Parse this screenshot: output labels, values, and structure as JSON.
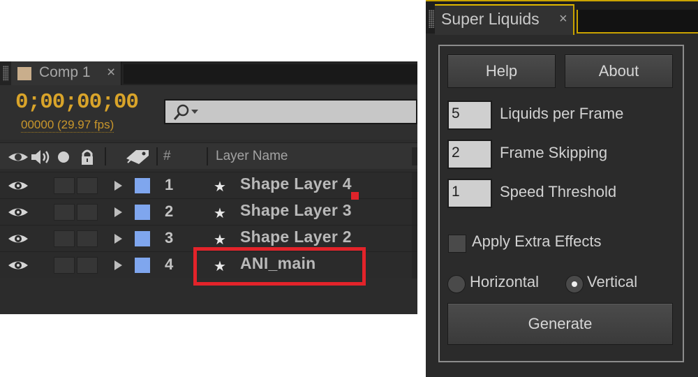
{
  "timeline": {
    "tab_label": "Comp 1",
    "tab_close": "×",
    "timecode": "0;00;00;00",
    "frame_count": "00000 (29.97 fps)",
    "search": {
      "value": ""
    },
    "columns": {
      "number": "#",
      "layer_name": "Layer Name"
    },
    "layers": [
      {
        "number": "1",
        "name": "Shape Layer 4",
        "label_color": "#7fa6ee"
      },
      {
        "number": "2",
        "name": "Shape Layer 3",
        "label_color": "#7fa6ee"
      },
      {
        "number": "3",
        "name": "Shape Layer 2",
        "label_color": "#7fa6ee"
      },
      {
        "number": "4",
        "name": "ANI_main",
        "label_color": "#7fa6ee"
      }
    ],
    "highlighted_layer": "ANI_main",
    "highlight_color": "#e3232a",
    "timecode_color": "#d9a42a"
  },
  "panel": {
    "title": "Super Liquids",
    "close": "×",
    "accent_color": "#c9a300",
    "help_label": "Help",
    "about_label": "About",
    "fields": [
      {
        "value": "5",
        "label": "Liquids per Frame"
      },
      {
        "value": "2",
        "label": "Frame Skipping"
      },
      {
        "value": "1",
        "label": "Speed Threshold"
      }
    ],
    "apply_extra_effects": {
      "label": "Apply Extra Effects",
      "checked": false
    },
    "orientation": {
      "options": [
        "Horizontal",
        "Vertical"
      ],
      "selected": "Vertical"
    },
    "generate_label": "Generate"
  }
}
